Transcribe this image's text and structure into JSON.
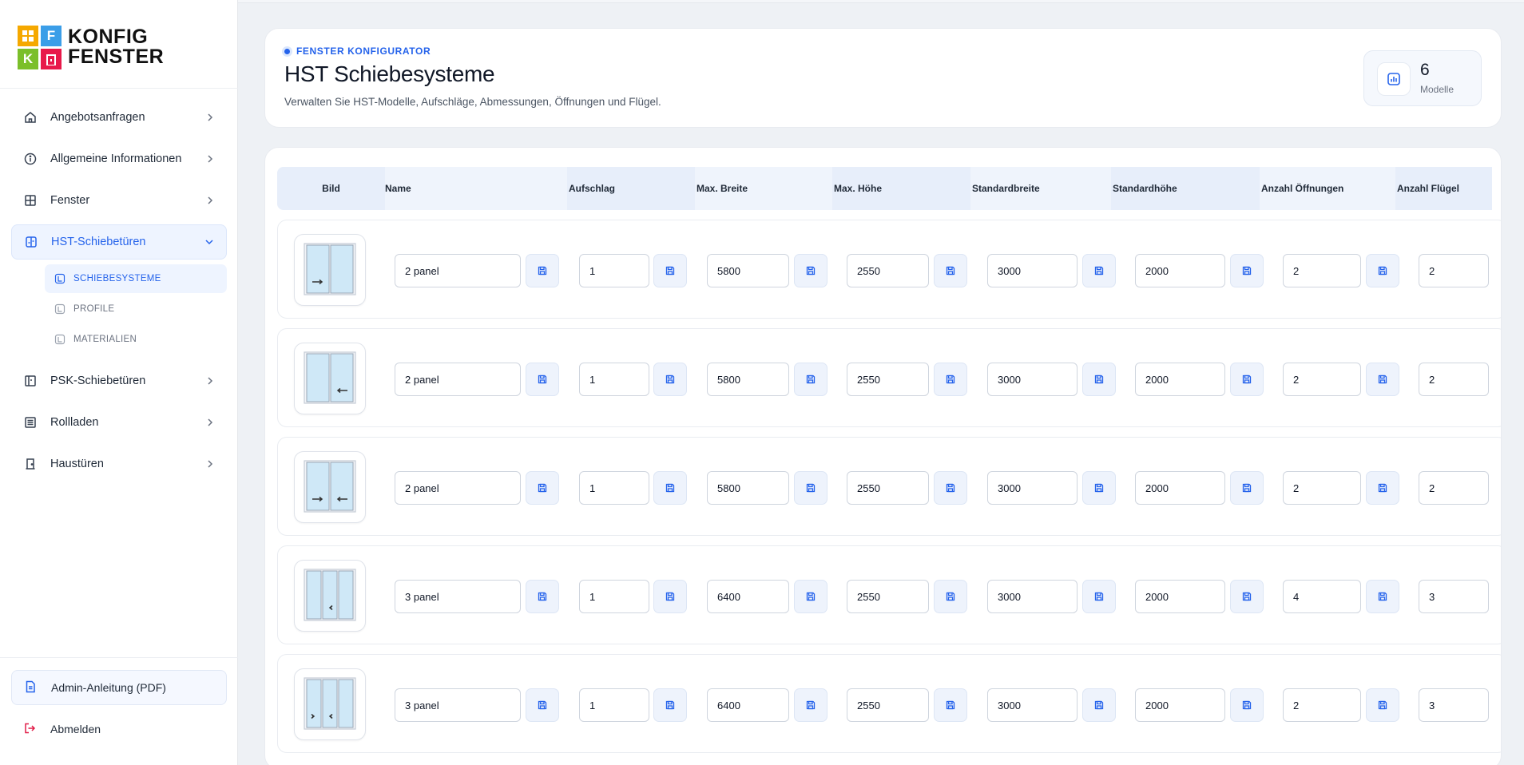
{
  "sidebar": {
    "logo": {
      "letters": [
        "",
        "F",
        "K",
        ""
      ],
      "line1": "KONFIG",
      "line2": "FENSTER"
    },
    "nav": [
      {
        "label": "Angebotsanfragen",
        "icon": "home-icon"
      },
      {
        "label": "Allgemeine Informationen",
        "icon": "info-icon"
      },
      {
        "label": "Fenster",
        "icon": "window-icon"
      },
      {
        "label": "HST-Schiebetüren",
        "icon": "sliding-door-icon",
        "active": true
      },
      {
        "label": "PSK-Schiebetüren",
        "icon": "psk-door-icon"
      },
      {
        "label": "Rollladen",
        "icon": "shutter-icon"
      },
      {
        "label": "Haustüren",
        "icon": "door-icon"
      }
    ],
    "subnav": [
      {
        "label": "SCHIEBESYSTEME",
        "active": true
      },
      {
        "label": "PROFILE"
      },
      {
        "label": "MATERIALIEN"
      }
    ],
    "admin_label": "Admin-Anleitung (PDF)",
    "logout_label": "Abmelden"
  },
  "header": {
    "eyebrow": "FENSTER KONFIGURATOR",
    "title": "HST Schiebesysteme",
    "subtitle": "Verwalten Sie HST-Modelle, Aufschläge, Abmessungen, Öffnungen und Flügel.",
    "stat_value": "6",
    "stat_label": "Modelle"
  },
  "table": {
    "columns": [
      "Bild",
      "Name",
      "Aufschlag",
      "Max. Breite",
      "Max. Höhe",
      "Standardbreite",
      "Standardhöhe",
      "Anzahl Öffnungen",
      "Anzahl Flügel"
    ],
    "rows": [
      {
        "panels": 2,
        "arrows": [
          "right",
          "none"
        ],
        "name": "2 panel",
        "aufschlag": "1",
        "max_breite": "5800",
        "max_hoehe": "2550",
        "std_breite": "3000",
        "std_hoehe": "2000",
        "oeffnungen": "2",
        "fluegel": "2"
      },
      {
        "panels": 2,
        "arrows": [
          "none",
          "left"
        ],
        "name": "2 panel",
        "aufschlag": "1",
        "max_breite": "5800",
        "max_hoehe": "2550",
        "std_breite": "3000",
        "std_hoehe": "2000",
        "oeffnungen": "2",
        "fluegel": "2"
      },
      {
        "panels": 2,
        "arrows": [
          "right",
          "left"
        ],
        "name": "2 panel",
        "aufschlag": "1",
        "max_breite": "5800",
        "max_hoehe": "2550",
        "std_breite": "3000",
        "std_hoehe": "2000",
        "oeffnungen": "2",
        "fluegel": "2"
      },
      {
        "panels": 3,
        "arrows": [
          "none",
          "left",
          "none"
        ],
        "name": "3 panel",
        "aufschlag": "1",
        "max_breite": "6400",
        "max_hoehe": "2550",
        "std_breite": "3000",
        "std_hoehe": "2000",
        "oeffnungen": "4",
        "fluegel": "3"
      },
      {
        "panels": 3,
        "arrows": [
          "right",
          "left",
          "none"
        ],
        "name": "3 panel",
        "aufschlag": "1",
        "max_breite": "6400",
        "max_hoehe": "2550",
        "std_breite": "3000",
        "std_hoehe": "2000",
        "oeffnungen": "2",
        "fluegel": "3"
      }
    ]
  },
  "colors": {
    "accent": "#2563eb",
    "logo": [
      "#f5a800",
      "#3b9ee8",
      "#7bbf2a",
      "#e8194a"
    ]
  }
}
